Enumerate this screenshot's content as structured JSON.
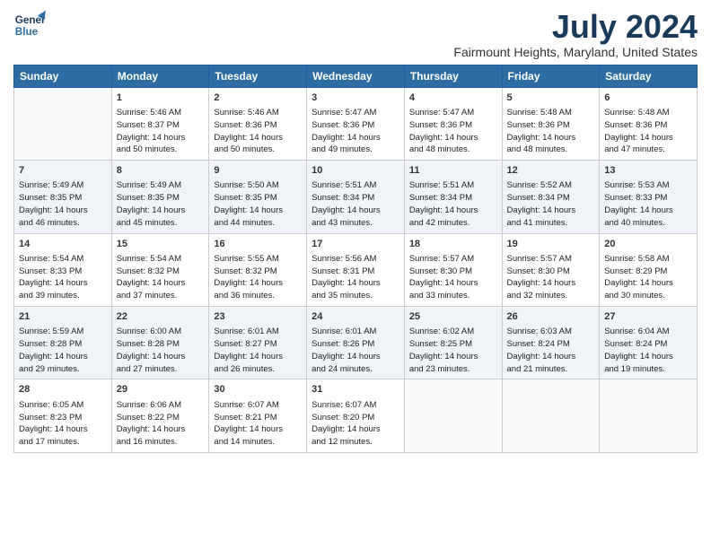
{
  "logo": {
    "line1": "General",
    "line2": "Blue"
  },
  "title": "July 2024",
  "subtitle": "Fairmount Heights, Maryland, United States",
  "days_of_week": [
    "Sunday",
    "Monday",
    "Tuesday",
    "Wednesday",
    "Thursday",
    "Friday",
    "Saturday"
  ],
  "weeks": [
    [
      {
        "day": "",
        "info": ""
      },
      {
        "day": "1",
        "info": "Sunrise: 5:46 AM\nSunset: 8:37 PM\nDaylight: 14 hours\nand 50 minutes."
      },
      {
        "day": "2",
        "info": "Sunrise: 5:46 AM\nSunset: 8:36 PM\nDaylight: 14 hours\nand 50 minutes."
      },
      {
        "day": "3",
        "info": "Sunrise: 5:47 AM\nSunset: 8:36 PM\nDaylight: 14 hours\nand 49 minutes."
      },
      {
        "day": "4",
        "info": "Sunrise: 5:47 AM\nSunset: 8:36 PM\nDaylight: 14 hours\nand 48 minutes."
      },
      {
        "day": "5",
        "info": "Sunrise: 5:48 AM\nSunset: 8:36 PM\nDaylight: 14 hours\nand 48 minutes."
      },
      {
        "day": "6",
        "info": "Sunrise: 5:48 AM\nSunset: 8:36 PM\nDaylight: 14 hours\nand 47 minutes."
      }
    ],
    [
      {
        "day": "7",
        "info": "Sunrise: 5:49 AM\nSunset: 8:35 PM\nDaylight: 14 hours\nand 46 minutes."
      },
      {
        "day": "8",
        "info": "Sunrise: 5:49 AM\nSunset: 8:35 PM\nDaylight: 14 hours\nand 45 minutes."
      },
      {
        "day": "9",
        "info": "Sunrise: 5:50 AM\nSunset: 8:35 PM\nDaylight: 14 hours\nand 44 minutes."
      },
      {
        "day": "10",
        "info": "Sunrise: 5:51 AM\nSunset: 8:34 PM\nDaylight: 14 hours\nand 43 minutes."
      },
      {
        "day": "11",
        "info": "Sunrise: 5:51 AM\nSunset: 8:34 PM\nDaylight: 14 hours\nand 42 minutes."
      },
      {
        "day": "12",
        "info": "Sunrise: 5:52 AM\nSunset: 8:34 PM\nDaylight: 14 hours\nand 41 minutes."
      },
      {
        "day": "13",
        "info": "Sunrise: 5:53 AM\nSunset: 8:33 PM\nDaylight: 14 hours\nand 40 minutes."
      }
    ],
    [
      {
        "day": "14",
        "info": "Sunrise: 5:54 AM\nSunset: 8:33 PM\nDaylight: 14 hours\nand 39 minutes."
      },
      {
        "day": "15",
        "info": "Sunrise: 5:54 AM\nSunset: 8:32 PM\nDaylight: 14 hours\nand 37 minutes."
      },
      {
        "day": "16",
        "info": "Sunrise: 5:55 AM\nSunset: 8:32 PM\nDaylight: 14 hours\nand 36 minutes."
      },
      {
        "day": "17",
        "info": "Sunrise: 5:56 AM\nSunset: 8:31 PM\nDaylight: 14 hours\nand 35 minutes."
      },
      {
        "day": "18",
        "info": "Sunrise: 5:57 AM\nSunset: 8:30 PM\nDaylight: 14 hours\nand 33 minutes."
      },
      {
        "day": "19",
        "info": "Sunrise: 5:57 AM\nSunset: 8:30 PM\nDaylight: 14 hours\nand 32 minutes."
      },
      {
        "day": "20",
        "info": "Sunrise: 5:58 AM\nSunset: 8:29 PM\nDaylight: 14 hours\nand 30 minutes."
      }
    ],
    [
      {
        "day": "21",
        "info": "Sunrise: 5:59 AM\nSunset: 8:28 PM\nDaylight: 14 hours\nand 29 minutes."
      },
      {
        "day": "22",
        "info": "Sunrise: 6:00 AM\nSunset: 8:28 PM\nDaylight: 14 hours\nand 27 minutes."
      },
      {
        "day": "23",
        "info": "Sunrise: 6:01 AM\nSunset: 8:27 PM\nDaylight: 14 hours\nand 26 minutes."
      },
      {
        "day": "24",
        "info": "Sunrise: 6:01 AM\nSunset: 8:26 PM\nDaylight: 14 hours\nand 24 minutes."
      },
      {
        "day": "25",
        "info": "Sunrise: 6:02 AM\nSunset: 8:25 PM\nDaylight: 14 hours\nand 23 minutes."
      },
      {
        "day": "26",
        "info": "Sunrise: 6:03 AM\nSunset: 8:24 PM\nDaylight: 14 hours\nand 21 minutes."
      },
      {
        "day": "27",
        "info": "Sunrise: 6:04 AM\nSunset: 8:24 PM\nDaylight: 14 hours\nand 19 minutes."
      }
    ],
    [
      {
        "day": "28",
        "info": "Sunrise: 6:05 AM\nSunset: 8:23 PM\nDaylight: 14 hours\nand 17 minutes."
      },
      {
        "day": "29",
        "info": "Sunrise: 6:06 AM\nSunset: 8:22 PM\nDaylight: 14 hours\nand 16 minutes."
      },
      {
        "day": "30",
        "info": "Sunrise: 6:07 AM\nSunset: 8:21 PM\nDaylight: 14 hours\nand 14 minutes."
      },
      {
        "day": "31",
        "info": "Sunrise: 6:07 AM\nSunset: 8:20 PM\nDaylight: 14 hours\nand 12 minutes."
      },
      {
        "day": "",
        "info": ""
      },
      {
        "day": "",
        "info": ""
      },
      {
        "day": "",
        "info": ""
      }
    ]
  ]
}
